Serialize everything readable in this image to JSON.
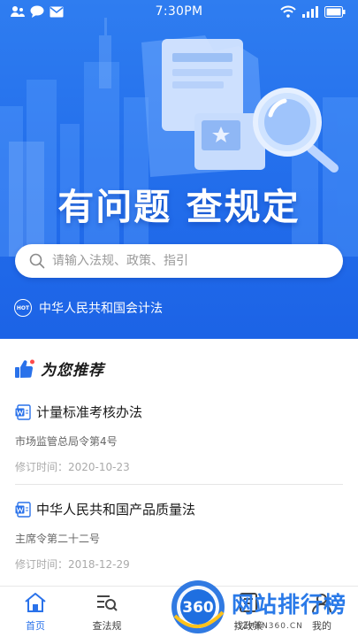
{
  "status_bar": {
    "time": "7:30PM"
  },
  "hero": {
    "title": "有问题 查规定",
    "search_placeholder": "请输入法规、政策、指引",
    "hot_badge": "HOT",
    "hot_text": "中华人民共和国会计法"
  },
  "recommend": {
    "title": "为您推荐",
    "items": [
      {
        "title": "计量标准考核办法",
        "issuer": "市场监管总局令第4号",
        "revised": "修订时间：2020-10-23"
      },
      {
        "title": "中华人民共和国产品质量法",
        "issuer": "主席令第二十二号",
        "revised": "修订时间：2018-12-29"
      }
    ]
  },
  "tabbar": {
    "tabs": [
      {
        "label": "首页",
        "icon": "home-icon",
        "active": true
      },
      {
        "label": "查法规",
        "icon": "list-search-icon",
        "active": false
      },
      {
        "label": "找政策",
        "icon": "policy-icon",
        "active": false
      },
      {
        "label": "我的",
        "icon": "user-icon",
        "active": false
      }
    ]
  },
  "watermark": {
    "brand": "网站排行榜",
    "badge": "360",
    "url": "GZHAN360.CN"
  },
  "colors": {
    "hero_blue": "#2470ec",
    "accent": "#2a72ea",
    "doc_icon": "#2a72ea"
  }
}
